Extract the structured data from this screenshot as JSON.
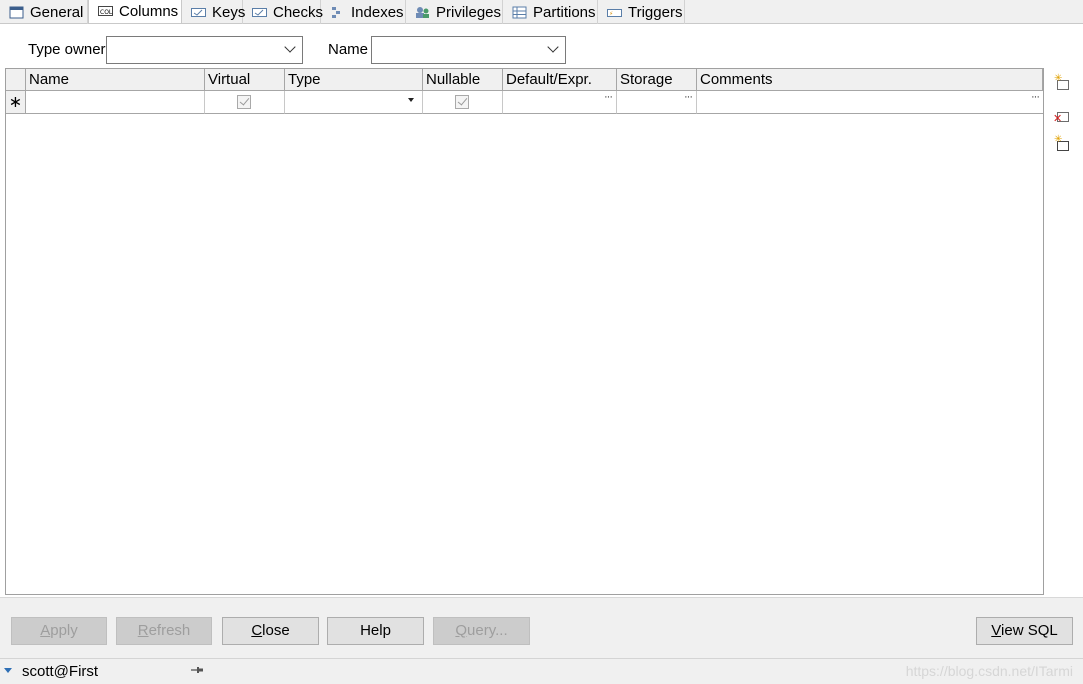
{
  "tabs": [
    {
      "label": "General",
      "icon": "window-icon"
    },
    {
      "label": "Columns",
      "icon": "columns-icon"
    },
    {
      "label": "Keys",
      "icon": "key-icon"
    },
    {
      "label": "Checks",
      "icon": "check-icon"
    },
    {
      "label": "Indexes",
      "icon": "index-icon"
    },
    {
      "label": "Privileges",
      "icon": "privileges-icon"
    },
    {
      "label": "Partitions",
      "icon": "partitions-icon"
    },
    {
      "label": "Triggers",
      "icon": "trigger-icon"
    }
  ],
  "active_tab": "Columns",
  "form": {
    "type_owner_label": "Type owner",
    "type_owner_value": "",
    "name_label": "Name",
    "name_value": ""
  },
  "grid": {
    "columns": [
      "Name",
      "Virtual",
      "Type",
      "Nullable",
      "Default/Expr.",
      "Storage",
      "Comments"
    ],
    "new_row_marker": "∗",
    "ellipsis": "···"
  },
  "buttons": {
    "apply": {
      "hot": "A",
      "rest": "pply"
    },
    "refresh": {
      "hot": "R",
      "rest": "efresh"
    },
    "close": {
      "hot": "C",
      "rest": "lose"
    },
    "help": "Help",
    "query": {
      "hot": "Q",
      "rest": "uery..."
    },
    "view_sql": {
      "hot": "V",
      "rest": "iew SQL"
    }
  },
  "status": {
    "connection": "scott@First",
    "watermark": "https://blog.csdn.net/ITarmi"
  }
}
